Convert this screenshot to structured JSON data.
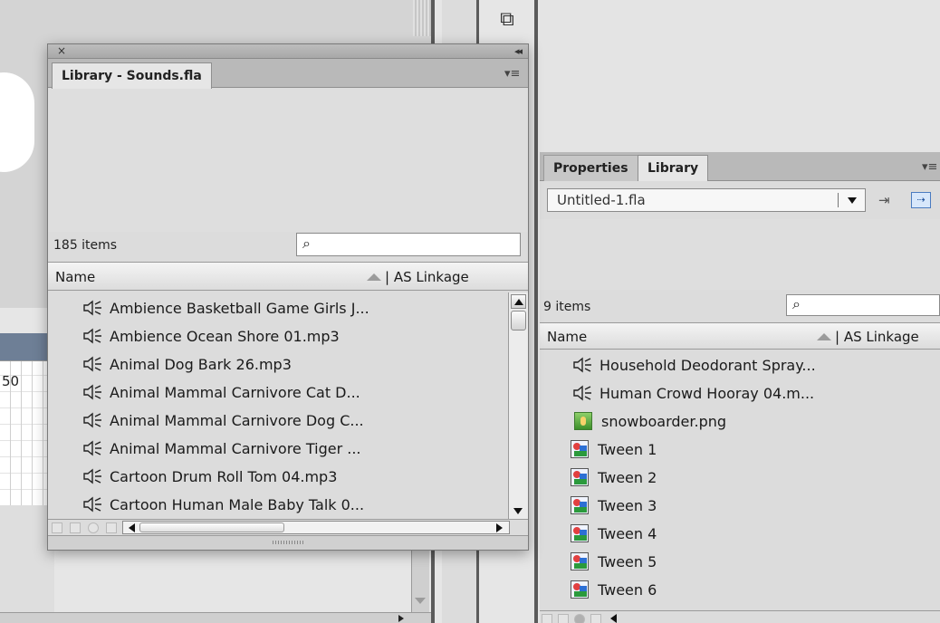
{
  "floating_library": {
    "close_glyph": "×",
    "collapse_glyph": "◂◂",
    "tab_title": "Library - Sounds.fla",
    "panel_menu_glyph": "▾≡",
    "item_count": "185 items",
    "search_placeholder": "",
    "col_name": "Name",
    "col_linkage": "| AS Linkage",
    "items": [
      "Ambience Basketball Game Girls J...",
      "Ambience Ocean Shore 01.mp3",
      "Animal Dog Bark 26.mp3",
      "Animal Mammal Carnivore Cat D...",
      "Animal Mammal Carnivore Dog C...",
      "Animal Mammal Carnivore Tiger ...",
      "Cartoon Drum Roll Tom 04.mp3",
      "Cartoon Human Male Baby Talk 0..."
    ]
  },
  "right_panel": {
    "tab_properties": "Properties",
    "tab_library": "Library",
    "panel_menu_glyph": "▾≡",
    "file_select_value": "Untitled-1.fla",
    "item_count": "9 items",
    "search_placeholder": "",
    "col_name": "Name",
    "col_linkage": "| AS Linkage",
    "items": [
      {
        "label": "Household Deodorant Spray...",
        "icon": "sound"
      },
      {
        "label": "Human Crowd Hooray 04.m...",
        "icon": "sound"
      },
      {
        "label": "snowboarder.png",
        "icon": "bitmap"
      },
      {
        "label": "Tween 1",
        "icon": "graphic"
      },
      {
        "label": "Tween 2",
        "icon": "graphic"
      },
      {
        "label": "Tween 3",
        "icon": "graphic"
      },
      {
        "label": "Tween 4",
        "icon": "graphic"
      },
      {
        "label": "Tween 5",
        "icon": "graphic"
      },
      {
        "label": "Tween 6",
        "icon": "graphic"
      }
    ]
  },
  "timeline": {
    "frame_label": "50"
  },
  "colors": {
    "panel_bg": "#dcdcdc",
    "tab_strip": "#b9b9b9",
    "timeline_accent": "#6e7f96"
  }
}
